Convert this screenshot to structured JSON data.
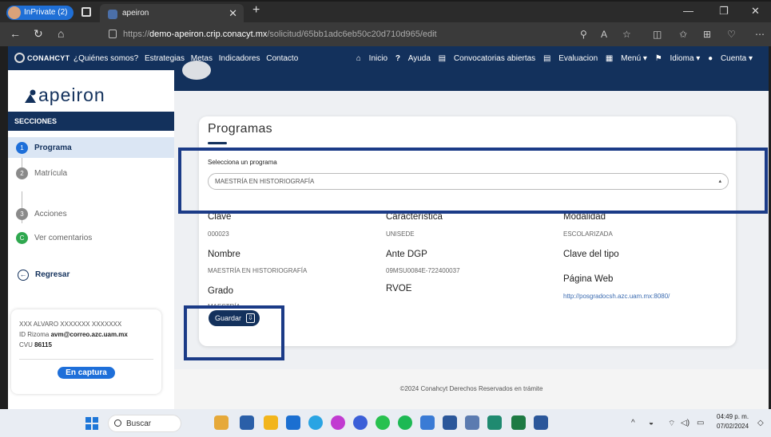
{
  "browser": {
    "inprivate_label": "InPrivate (2)",
    "tab_title": "apeiron",
    "url_prefix": "https://",
    "url_host": "demo-apeiron.crip.conacyt.mx",
    "url_path": "/solicitud/65bb1adc6eb50c20d710d965/edit"
  },
  "topnav": {
    "logo": "CONAHCYT",
    "left_links": [
      "¿Quiénes somos?",
      "Estrategias",
      "Metas",
      "Indicadores",
      "Contacto"
    ],
    "right_links": [
      "Inicio",
      "Ayuda",
      "Convocatorias abiertas",
      "Evaluacion",
      "Menú",
      "Idioma",
      "Cuenta"
    ]
  },
  "sidebar": {
    "brand": "apeiron",
    "section_title": "SECCIONES",
    "steps": [
      {
        "num": "1",
        "label": "Programa"
      },
      {
        "num": "2",
        "label": "Matrícula"
      },
      {
        "num": "3",
        "label": "Acciones"
      },
      {
        "num": "C",
        "label": "Ver comentarios"
      }
    ],
    "back_label": "Regresar",
    "user": {
      "name": "XXX ALVARO XXXXXXX XXXXXXX",
      "rizoma_label": "ID Rizoma",
      "rizoma_value": "avm@correo.azc.uam.mx",
      "cvu_label": "CVU",
      "cvu_value": "86115",
      "status": "En captura"
    }
  },
  "main": {
    "title": "Programas",
    "select_label": "Selecciona un programa",
    "select_value": "MAESTRÍA EN HISTORIOGRAFÍA",
    "fields": {
      "clave_label": "Clave",
      "clave_value": "000023",
      "caracteristica_label": "Característica",
      "caracteristica_value": "UNISEDE",
      "modalidad_label": "Modalidad",
      "modalidad_value": "ESCOLARIZADA",
      "nombre_label": "Nombre",
      "nombre_value": "MAESTRÍA EN HISTORIOGRAFÍA",
      "ante_dgp_label": "Ante DGP",
      "ante_dgp_value": "09MSU0084E-722400037",
      "clave_tipo_label": "Clave del tipo",
      "grado_label": "Grado",
      "grado_value": "MAESTRÍA",
      "rvoe_label": "RVOE",
      "pagina_web_label": "Página Web",
      "pagina_web_value": "http://posgradocsh.azc.uam.mx:8080/"
    },
    "save_label": "Guardar",
    "footer": "©2024 Conahcyt Derechos Reservados en trámite"
  },
  "taskbar": {
    "search_label": "Buscar",
    "time": "04:49 p. m.",
    "date": "07/02/2024"
  },
  "colors": {
    "navy": "#13315c",
    "accent_blue": "#1e6fd9",
    "highlight_box": "#1b3b87"
  }
}
